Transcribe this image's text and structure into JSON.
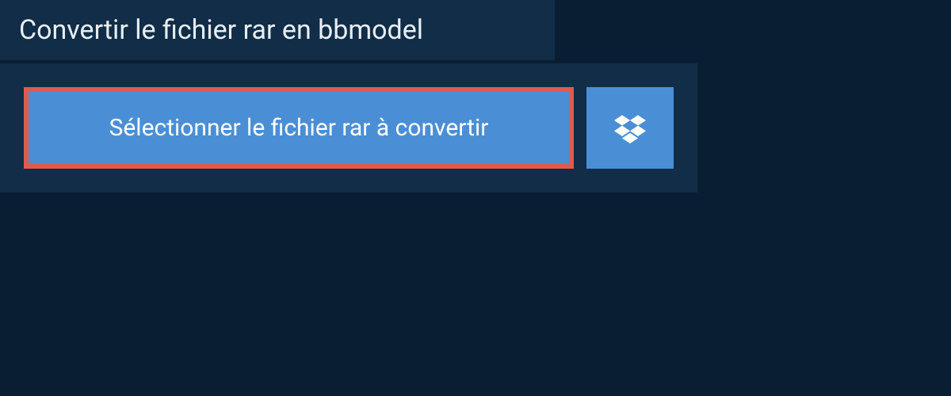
{
  "header": {
    "title": "Convertir le fichier rar en bbmodel"
  },
  "upload": {
    "select_label": "Sélectionner le fichier rar à convertir"
  },
  "colors": {
    "background": "#0a1e33",
    "panel": "#112d47",
    "button": "#4a8fd6",
    "highlight_border": "#e15a4d",
    "text_light": "#e8eef4"
  }
}
